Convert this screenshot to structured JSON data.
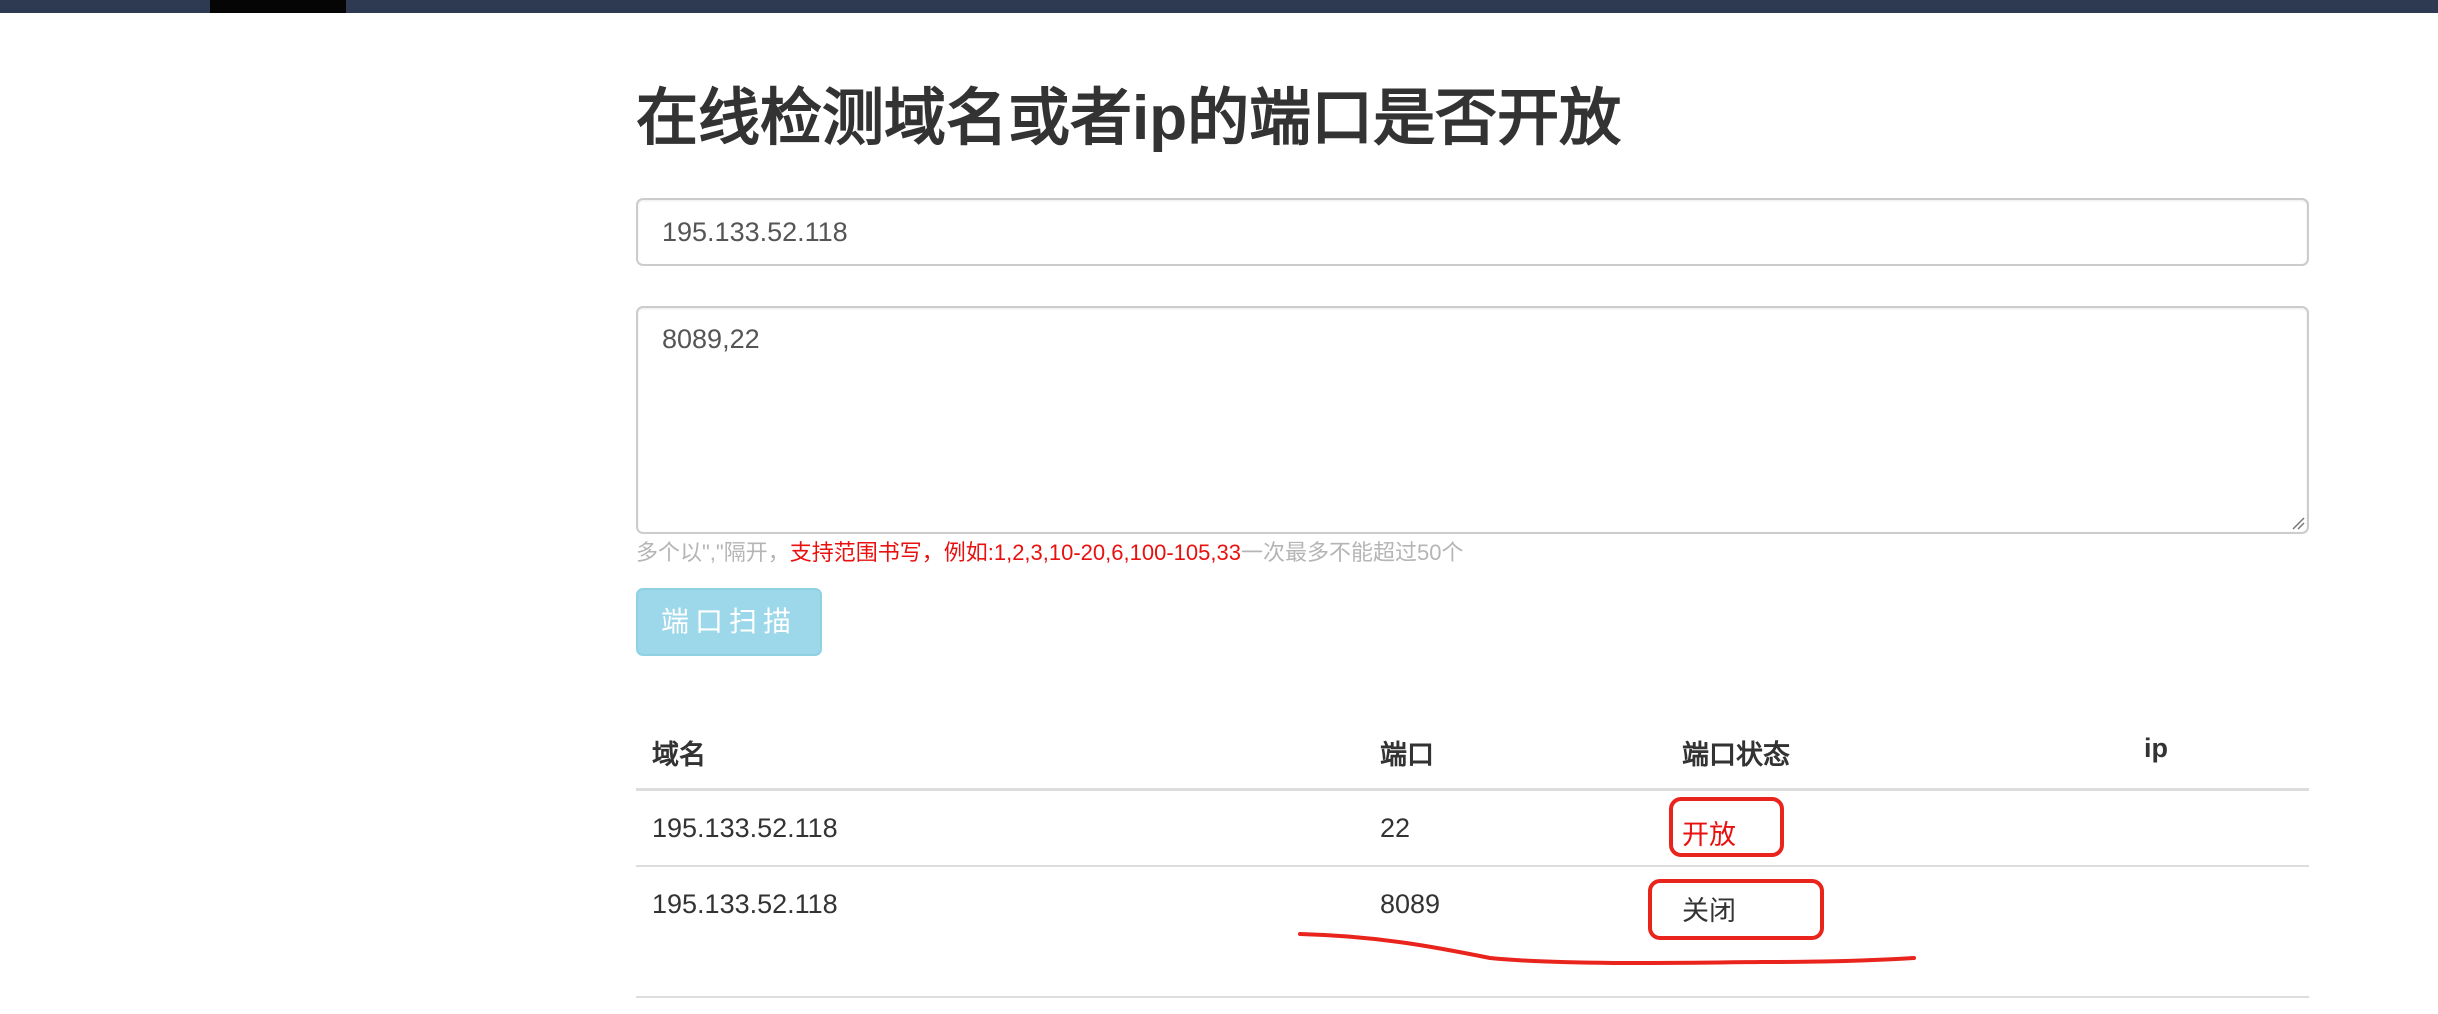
{
  "page": {
    "title": "在线检测域名或者ip的端口是否开放"
  },
  "form": {
    "domain_value": "195.133.52.118",
    "ports_value": "8089,22",
    "help_prefix": "多个以\",\"隔开，",
    "help_highlight": "支持范围书写，例如:1,2,3,10-20,6,100-105,33",
    "help_suffix": "一次最多不能超过50个",
    "scan_button_label": "端口扫描"
  },
  "results_table": {
    "headers": {
      "domain": "域名",
      "port": "端口",
      "status": "端口状态",
      "ip": "ip"
    },
    "rows": [
      {
        "domain": "195.133.52.118",
        "port": "22",
        "status": "开放",
        "ip": ""
      },
      {
        "domain": "195.133.52.118",
        "port": "8089",
        "status": "关闭",
        "ip": ""
      }
    ]
  },
  "colors": {
    "topbar": "#2e3a52",
    "accent_red": "#e8110f",
    "button_bg": "#9dd8ea",
    "annotation_red": "#e8241c"
  }
}
